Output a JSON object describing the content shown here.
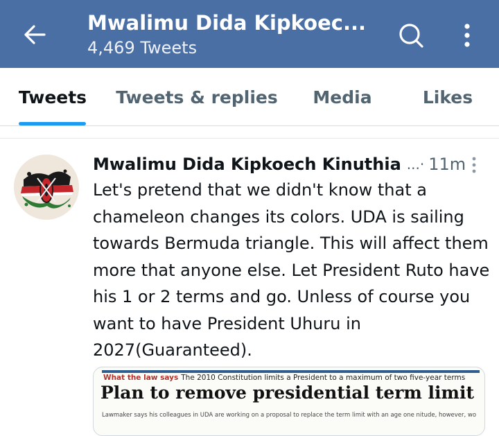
{
  "header": {
    "title": "Mwalimu Dida Kipkoec...",
    "subtitle": "4,469 Tweets",
    "back_icon": "arrow-left-icon",
    "search_icon": "search-icon",
    "more_icon": "more-vertical-icon"
  },
  "tabs": [
    {
      "label": "Tweets",
      "active": true
    },
    {
      "label": "Tweets & replies",
      "active": false
    },
    {
      "label": "Media",
      "active": false
    },
    {
      "label": "Likes",
      "active": false
    }
  ],
  "tweet": {
    "author": "Mwalimu Dida Kipkoech Kinuthia",
    "truncation": "...·",
    "time": "11m",
    "text": "Let's pretend that we didn't know that a chameleon changes its colors. UDA is sailing towards Bermuda triangle. This will affect them more that anyone else. Let President Ruto have his 1 or 2 terms and go. Unless of course you want to have President Uhuru in 2027(Guaranteed).",
    "media": {
      "kicker_label": "What the law says",
      "kicker_text": "The 2010 Constitution limits a President to a maximum of two five-year terms",
      "headline": "Plan to remove presidential term limit",
      "body": "Lawmaker says his colleagues in UDA are working on a proposal to replace the term limit with an age one          nitude, however, would require"
    }
  },
  "colors": {
    "header_bg": "#4a6fa5",
    "accent": "#1d9bf0",
    "muted": "#536471"
  }
}
